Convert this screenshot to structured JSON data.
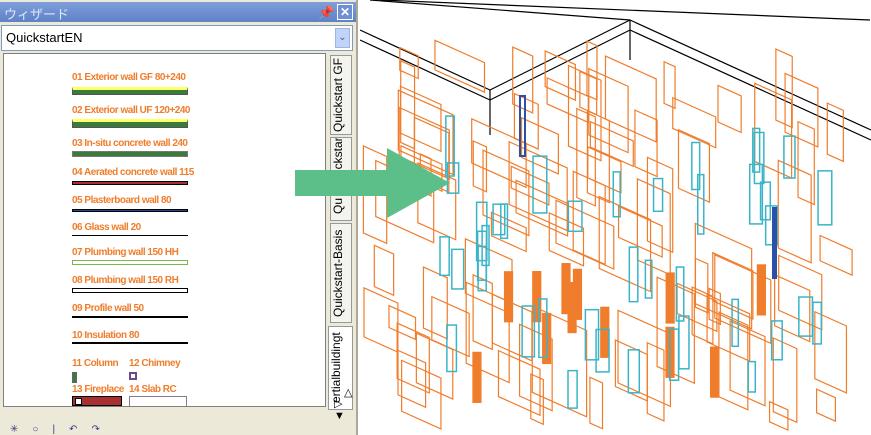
{
  "panel": {
    "title": "ウィザード",
    "pin_icon": "pin-icon",
    "close_label": "✕",
    "combo_value": "QuickstartEN"
  },
  "items": [
    {
      "label": "01 Exterior wall GF  80+240"
    },
    {
      "label": "02 Exterior wall UF 120+240"
    },
    {
      "label": "03 In-situ concrete wall  240"
    },
    {
      "label": "04 Aerated concrete wall 115"
    },
    {
      "label": "05 Plasterboard wall  80"
    },
    {
      "label": "06 Glass wall 20"
    },
    {
      "label": "07 Plumbing wall 150 HH"
    },
    {
      "label": "08 Plumbing wall 150 RH"
    },
    {
      "label": "09 Profile wall  50"
    },
    {
      "label": "10 Insulation 80"
    },
    {
      "label": "11 Column"
    },
    {
      "label": "12 Chimney"
    },
    {
      "label": "13 Fireplace"
    },
    {
      "label": "14 Slab RC"
    }
  ],
  "tabs": [
    "Quickstart GF",
    "Quickstart UF",
    "Qu",
    "Quickstart-Basis",
    "ertialbuildingt"
  ],
  "nav": {
    "next": "▷",
    "up": "△",
    "down": "▼"
  },
  "colors": {
    "orange": "#f07d2c",
    "green": "#3a7a3a",
    "arrow": "#5cbf8a",
    "cyan": "#3ab4c8"
  }
}
